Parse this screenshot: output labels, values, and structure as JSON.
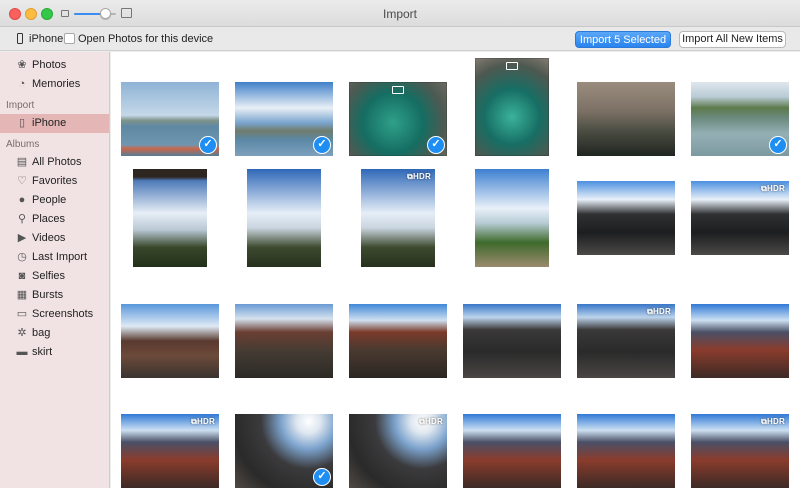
{
  "window": {
    "title": "Import"
  },
  "toolbar": {
    "device_name": "iPhone",
    "open_photos_label": "Open Photos for this device",
    "open_photos_checked": false,
    "import_selected_label": "Import 5 Selected",
    "import_all_label": "Import All New Items",
    "zoom_level": 0.75
  },
  "sidebar": {
    "library": [
      {
        "label": "Photos",
        "icon": "photos-icon"
      },
      {
        "label": "Memories",
        "icon": "memories-icon"
      }
    ],
    "import_heading": "Import",
    "import_items": [
      {
        "label": "iPhone",
        "icon": "iphone-icon",
        "active": true
      }
    ],
    "albums_heading": "Albums",
    "albums": [
      {
        "label": "All Photos",
        "icon": "photo-stack-icon"
      },
      {
        "label": "Favorites",
        "icon": "heart-icon"
      },
      {
        "label": "People",
        "icon": "person-icon"
      },
      {
        "label": "Places",
        "icon": "pin-icon"
      },
      {
        "label": "Videos",
        "icon": "video-icon"
      },
      {
        "label": "Last Import",
        "icon": "clock-icon"
      },
      {
        "label": "Selfies",
        "icon": "camera-icon"
      },
      {
        "label": "Bursts",
        "icon": "bursts-icon"
      },
      {
        "label": "Screenshots",
        "icon": "screenshot-icon"
      },
      {
        "label": "bag",
        "icon": "gear-icon"
      },
      {
        "label": "skirt",
        "icon": "album-thumb-icon"
      }
    ]
  },
  "colors": {
    "accent": "#2a84ee",
    "sidebar_bg": "#f1e3e3",
    "sidebar_active": "#e4b6b6",
    "check_blue": "#1e8ef2"
  },
  "photos": [
    {
      "scene": "lake-boats",
      "selected": true,
      "badge": "",
      "live": false,
      "orientation": "landscape"
    },
    {
      "scene": "lake-clouds",
      "selected": true,
      "badge": "",
      "live": false,
      "orientation": "landscape"
    },
    {
      "scene": "spring-teal",
      "selected": true,
      "badge": "",
      "live": true,
      "orientation": "landscape"
    },
    {
      "scene": "spring-teal-portrait",
      "selected": false,
      "badge": "",
      "live": true,
      "orientation": "portrait"
    },
    {
      "scene": "stone-pool",
      "selected": false,
      "badge": "",
      "live": false,
      "orientation": "landscape"
    },
    {
      "scene": "lake-reflection",
      "selected": true,
      "badge": "",
      "live": false,
      "orientation": "landscape"
    },
    {
      "scene": "gate-pagoda",
      "selected": false,
      "badge": "",
      "live": false,
      "orientation": "portrait"
    },
    {
      "scene": "pagoda-sky",
      "selected": false,
      "badge": "",
      "live": false,
      "orientation": "portrait"
    },
    {
      "scene": "pagoda-sky",
      "selected": false,
      "badge": "HDR",
      "live": false,
      "orientation": "portrait"
    },
    {
      "scene": "pagoda-tree",
      "selected": false,
      "badge": "",
      "live": false,
      "orientation": "portrait"
    },
    {
      "scene": "temple-dark",
      "selected": false,
      "badge": "",
      "live": false,
      "orientation": "landscape"
    },
    {
      "scene": "temple-dark",
      "selected": false,
      "badge": "HDR",
      "live": false,
      "orientation": "landscape"
    },
    {
      "scene": "gate-crowd",
      "selected": false,
      "badge": "",
      "live": false,
      "orientation": "landscape"
    },
    {
      "scene": "hall-tree",
      "selected": false,
      "badge": "",
      "live": false,
      "orientation": "landscape"
    },
    {
      "scene": "hall-red",
      "selected": false,
      "badge": "",
      "live": false,
      "orientation": "landscape"
    },
    {
      "scene": "hall-dark",
      "selected": false,
      "badge": "",
      "live": false,
      "orientation": "landscape"
    },
    {
      "scene": "hall-dark",
      "selected": false,
      "badge": "HDR",
      "live": false,
      "orientation": "landscape"
    },
    {
      "scene": "hall-colorful",
      "selected": false,
      "badge": "",
      "live": false,
      "orientation": "landscape"
    },
    {
      "scene": "hall-colorful",
      "selected": false,
      "badge": "HDR",
      "live": false,
      "orientation": "landscape"
    },
    {
      "scene": "hall-sun",
      "selected": true,
      "badge": "",
      "live": false,
      "orientation": "landscape"
    },
    {
      "scene": "hall-sun",
      "selected": false,
      "badge": "HDR",
      "live": false,
      "orientation": "landscape"
    },
    {
      "scene": "hall-colorful",
      "selected": false,
      "badge": "",
      "live": false,
      "orientation": "landscape"
    },
    {
      "scene": "hall-colorful",
      "selected": false,
      "badge": "",
      "live": false,
      "orientation": "landscape"
    },
    {
      "scene": "hall-colorful",
      "selected": false,
      "badge": "HDR",
      "live": false,
      "orientation": "landscape"
    }
  ]
}
